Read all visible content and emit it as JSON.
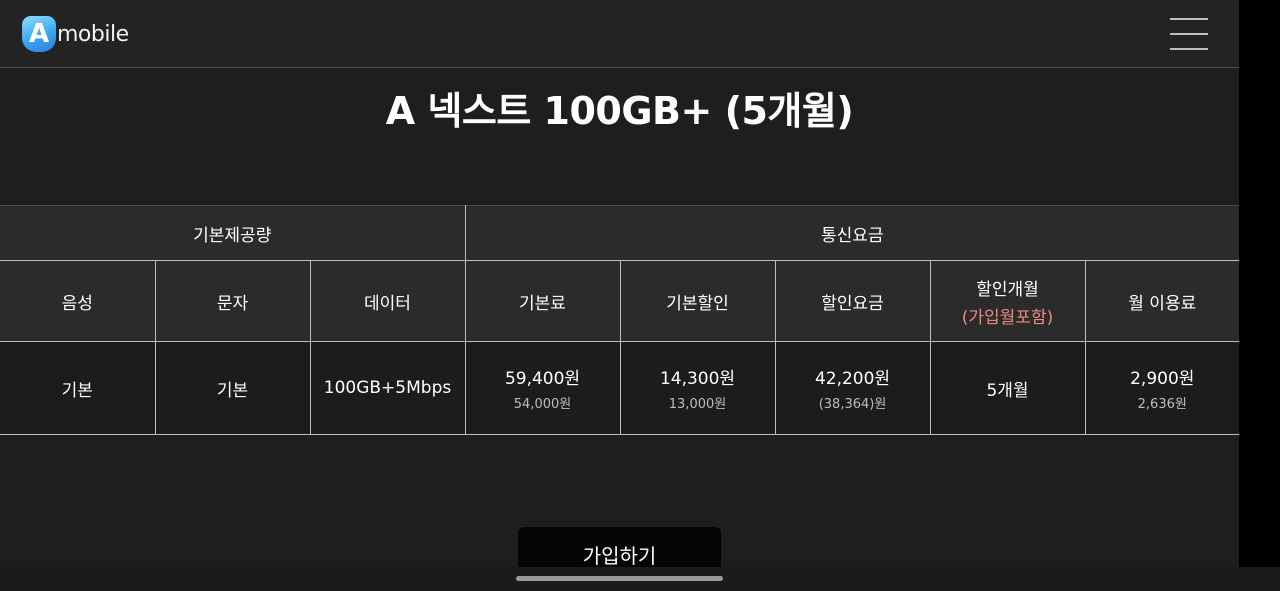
{
  "header": {
    "logo_mark": "A",
    "logo_text": "mobile",
    "menu_icon": "hamburger-menu-icon"
  },
  "title": "A 넥스트 100GB+ (5개월)",
  "table": {
    "groups": [
      "기본제공량",
      "통신요금"
    ],
    "columns": {
      "voice": "음성",
      "sms": "문자",
      "data": "데이터",
      "base_fee": "기본료",
      "base_discount": "기본할인",
      "discount_fee": "할인요금",
      "discount_months": "할인개월",
      "discount_months_note": "(가입월포함)",
      "monthly_fee": "월 이용료"
    },
    "row": {
      "voice": "기본",
      "sms": "기본",
      "data": "100GB+5Mbps",
      "base_fee": "59,400원",
      "base_fee_sub": "54,000원",
      "base_discount": "14,300원",
      "base_discount_sub": "13,000원",
      "discount_fee": "42,200원",
      "discount_fee_sub": "(38,364)원",
      "discount_months": "5개월",
      "monthly_fee": "2,900원",
      "monthly_fee_sub": "2,636원"
    }
  },
  "join_button": "가입하기",
  "colors": {
    "background": "#1e1e1e",
    "header": "#232323",
    "table_header": "#2b2b2b",
    "accent_red": "#e88a84",
    "button": "#050505"
  }
}
